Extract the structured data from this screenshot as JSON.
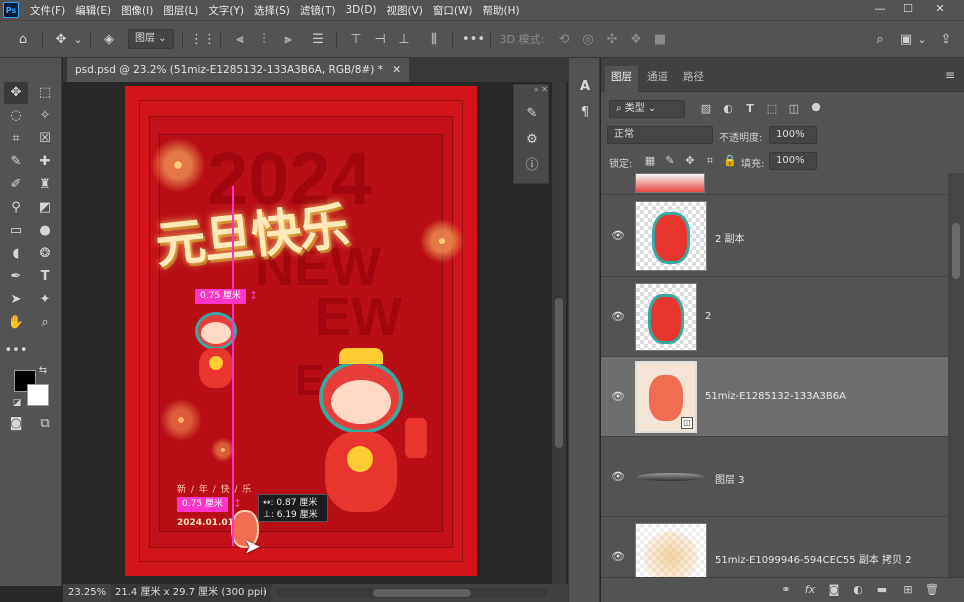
{
  "menu": [
    "文件(F)",
    "编辑(E)",
    "图像(I)",
    "图层(L)",
    "文字(Y)",
    "选择(S)",
    "滤镜(T)",
    "3D(D)",
    "视图(V)",
    "窗口(W)",
    "帮助(H)"
  ],
  "app_logo": "Ps",
  "options": {
    "layer_select": "图层",
    "mode_3d_label": "3D 模式:"
  },
  "document": {
    "tab_title": "psd.psd @ 23.2% (51miz-E1285132-133A3B6A, RGB/8#) *",
    "zoom": "23.25%",
    "doc_size": "21.4 厘米 x 29.7 厘米 (300 ppi)"
  },
  "poster": {
    "title": "元旦快乐",
    "year_bg": "2024",
    "bg_word_1": "NEW",
    "bg_word_2": "EW",
    "bg_word_3": "EAR",
    "date_text": "2024.01.01",
    "sub_text": "新 / 年 / 快 / 乐"
  },
  "measure": {
    "tag_top": "0.75 厘米",
    "tag_bottom": "0.75 厘米",
    "tooltip_x": "↔: 0.87 厘米",
    "tooltip_y": "⊥: 6.19 厘米"
  },
  "panel": {
    "tabs": [
      "图层",
      "通道",
      "路径"
    ],
    "filter_type": "类型",
    "blend_mode": "正常",
    "opacity_label": "不透明度:",
    "opacity_value": "100%",
    "lock_label": "锁定:",
    "fill_label": "填充:",
    "fill_value": "100%"
  },
  "layers": [
    {
      "name": "2 副本",
      "visible": true,
      "selected": false
    },
    {
      "name": "2",
      "visible": true,
      "selected": false
    },
    {
      "name": "51miz-E1285132-133A3B6A",
      "visible": true,
      "selected": true
    },
    {
      "name": "图层 3",
      "visible": true,
      "selected": false
    },
    {
      "name": "51miz-E1099946-594CEC55 副本 拷贝 2",
      "visible": true,
      "selected": false
    }
  ],
  "colors": {
    "poster_red": "#d2141b",
    "guide_magenta": "#ff2fd0",
    "gold": "#ffe9b8"
  }
}
